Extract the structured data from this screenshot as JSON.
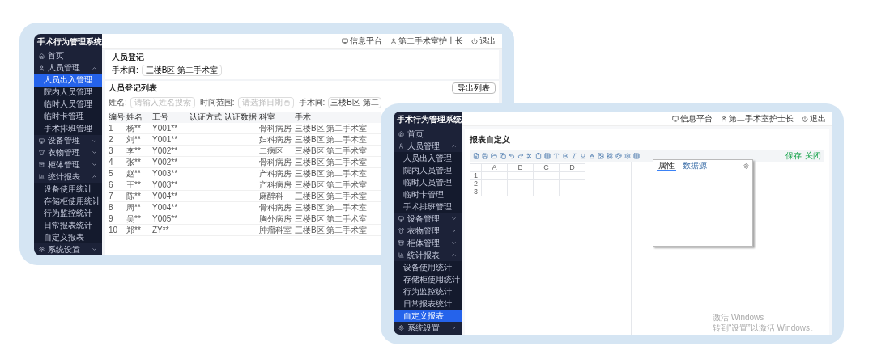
{
  "back_window": {
    "app_title": "手术行为管理系统",
    "header": [
      {
        "kind": "platform",
        "label": "信息平台"
      },
      {
        "kind": "user",
        "label": "第二手术室护士长"
      },
      {
        "kind": "logout",
        "label": "退出"
      }
    ],
    "sidebar": [
      {
        "label": "首页",
        "selected": false
      },
      {
        "label": "人员管理",
        "selected": false,
        "expanded": true,
        "children": [
          {
            "label": "人员出入管理",
            "selected": true
          },
          {
            "label": "院内人员管理",
            "selected": false
          },
          {
            "label": "临时人员管理",
            "selected": false
          },
          {
            "label": "临时卡管理",
            "selected": false
          },
          {
            "label": "手术排班管理",
            "selected": false
          }
        ]
      },
      {
        "label": "设备管理",
        "selected": false,
        "expanded": false
      },
      {
        "label": "衣物管理",
        "selected": false,
        "expanded": false
      },
      {
        "label": "柜体管理",
        "selected": false,
        "expanded": false
      },
      {
        "label": "统计报表",
        "selected": false,
        "expanded": true,
        "children": [
          {
            "label": "设备使用统计",
            "selected": false
          },
          {
            "label": "存储柜使用统计",
            "selected": false
          },
          {
            "label": "行为监控统计",
            "selected": false
          },
          {
            "label": "日常报表统计",
            "selected": false
          },
          {
            "label": "自定义报表",
            "selected": false
          }
        ]
      },
      {
        "label": "系统设置",
        "selected": false,
        "expanded": false
      }
    ],
    "register_card": {
      "title": "人员登记",
      "field": {
        "label": "手术间:",
        "value": "三楼B区 第二手术室"
      }
    },
    "list_card": {
      "title": "人员登记列表",
      "export_button": "导出列表",
      "filters": [
        {
          "kind": "text",
          "label": "姓名:",
          "placeholder": "请输入姓名搜索"
        },
        {
          "kind": "date",
          "label": "时间范围:",
          "placeholder": "请选择日期"
        },
        {
          "kind": "select",
          "label": "手术间:",
          "value": "三楼B区 第二"
        }
      ],
      "table": {
        "columns": [
          "编号",
          "姓名",
          "工号",
          "认证方式",
          "认证数据",
          "科室",
          "手术"
        ],
        "rows": [
          {
            "no": "1",
            "name": "杨**",
            "job_no": "Y001**",
            "dept": "骨科病房",
            "surgery": "三楼B区 第二手术室"
          },
          {
            "no": "2",
            "name": "刘**",
            "job_no": "Y001**",
            "dept": "妇科病房",
            "surgery": "三楼B区 第二手术室"
          },
          {
            "no": "3",
            "name": "李**",
            "job_no": "Y002**",
            "dept": "二病区",
            "surgery": "三楼B区 第二手术室"
          },
          {
            "no": "4",
            "name": "张**",
            "job_no": "Y002**",
            "dept": "骨科病房",
            "surgery": "三楼B区 第二手术室"
          },
          {
            "no": "5",
            "name": "赵**",
            "job_no": "Y003**",
            "dept": "产科病房",
            "surgery": "三楼B区 第二手术室"
          },
          {
            "no": "6",
            "name": "王**",
            "job_no": "Y003**",
            "dept": "产科病房",
            "surgery": "三楼B区 第二手术室"
          },
          {
            "no": "7",
            "name": "陈**",
            "job_no": "Y004**",
            "dept": "麻醉科",
            "surgery": "三楼B区 第二手术室"
          },
          {
            "no": "8",
            "name": "周**",
            "job_no": "Y004**",
            "dept": "骨科病房",
            "surgery": "三楼B区 第二手术室"
          },
          {
            "no": "9",
            "name": "吴**",
            "job_no": "Y005**",
            "dept": "胸外病房",
            "surgery": "三楼B区 第二手术室"
          },
          {
            "no": "10",
            "name": "郑**",
            "job_no": "ZY**",
            "dept": "肿瘤科室",
            "surgery": "三楼B区 第二手术室"
          }
        ]
      }
    }
  },
  "front_window": {
    "app_title": "手术行为管理系统",
    "header": [
      {
        "kind": "platform",
        "label": "信息平台"
      },
      {
        "kind": "user",
        "label": "第二手术室护士长"
      },
      {
        "kind": "logout",
        "label": "退出"
      }
    ],
    "sidebar": [
      {
        "label": "首页",
        "selected": false
      },
      {
        "label": "人员管理",
        "selected": false,
        "expanded": true,
        "children": [
          {
            "label": "人员出入管理",
            "selected": false
          },
          {
            "label": "院内人员管理",
            "selected": false
          },
          {
            "label": "临时人员管理",
            "selected": false
          },
          {
            "label": "临时卡管理",
            "selected": false
          },
          {
            "label": "手术排班管理",
            "selected": false
          }
        ]
      },
      {
        "label": "设备管理",
        "selected": false,
        "expanded": false
      },
      {
        "label": "衣物管理",
        "selected": false,
        "expanded": false
      },
      {
        "label": "柜体管理",
        "selected": false,
        "expanded": false
      },
      {
        "label": "统计报表",
        "selected": false,
        "expanded": true,
        "children": [
          {
            "label": "设备使用统计",
            "selected": false
          },
          {
            "label": "存储柜使用统计",
            "selected": false
          },
          {
            "label": "行为监控统计",
            "selected": false
          },
          {
            "label": "日常报表统计",
            "selected": false
          },
          {
            "label": "自定义报表",
            "selected": true
          }
        ]
      },
      {
        "label": "系统设置",
        "selected": false,
        "expanded": false
      }
    ],
    "page_title": "报表自定义",
    "editor": {
      "actions": [
        "保存",
        "关闭"
      ],
      "sheet": {
        "columns": [
          "A",
          "B",
          "C",
          "D"
        ],
        "rows": [
          "1",
          "2",
          "3"
        ]
      },
      "panel": {
        "tabs": [
          {
            "label": "属性",
            "selected": true
          },
          {
            "label": "数据源",
            "selected": false
          }
        ]
      }
    },
    "os_notice": {
      "title": "激活 Windows",
      "text": "转到“设置”以激活 Windows。"
    }
  }
}
